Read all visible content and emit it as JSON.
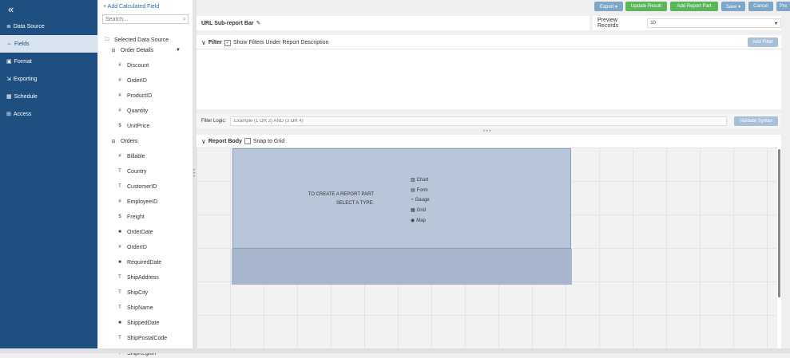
{
  "nav": {
    "collapse_glyph": "«",
    "items": [
      {
        "label": "Data Source",
        "icon": "≣"
      },
      {
        "label": "Fields",
        "icon": "⇔"
      },
      {
        "label": "Format",
        "icon": "▣"
      },
      {
        "label": "Exporting",
        "icon": "⇲"
      },
      {
        "label": "Schedule",
        "icon": "▦"
      },
      {
        "label": "Access",
        "icon": "⊞"
      }
    ]
  },
  "fields_panel": {
    "add_calc": "+ Add Calculated Field",
    "search_placeholder": "Search...",
    "root": "Selected Data Source",
    "groups": [
      {
        "name": "Order Details",
        "fields": [
          {
            "icon": "#",
            "name": "Discount"
          },
          {
            "icon": "#",
            "name": "OrderID"
          },
          {
            "icon": "#",
            "name": "ProductID"
          },
          {
            "icon": "#",
            "name": "Quantity"
          },
          {
            "icon": "$",
            "name": "UnitPrice"
          }
        ]
      },
      {
        "name": "Orders",
        "fields": [
          {
            "icon": "#",
            "name": "Billable"
          },
          {
            "icon": "T",
            "name": "Country"
          },
          {
            "icon": "T",
            "name": "CustomerID"
          },
          {
            "icon": "#",
            "name": "EmployeeID"
          },
          {
            "icon": "$",
            "name": "Freight"
          },
          {
            "icon": "■",
            "name": "OrderDate"
          },
          {
            "icon": "#",
            "name": "OrderID"
          },
          {
            "icon": "■",
            "name": "RequiredDate"
          },
          {
            "icon": "T",
            "name": "ShipAddress"
          },
          {
            "icon": "T",
            "name": "ShipCity"
          },
          {
            "icon": "T",
            "name": "ShipName"
          },
          {
            "icon": "■",
            "name": "ShippedDate"
          },
          {
            "icon": "T",
            "name": "ShipPostalCode"
          },
          {
            "icon": "T",
            "name": "ShipRegion"
          }
        ]
      }
    ]
  },
  "toolbar": {
    "export": "Export ▾",
    "update": "Update Result",
    "add_part": "Add Report Part",
    "save": "Save ▾",
    "cancel": "Cancel",
    "preview_btn": "Pre"
  },
  "url_bar": {
    "label": "URL Sub-report Bar"
  },
  "preview": {
    "label": "Preview Records",
    "value": "10"
  },
  "filter": {
    "title": "Filter",
    "show_under": "Show Filters Under Report Description",
    "add_filter": "Add Filter",
    "logic_label": "Filter Logic:",
    "logic_placeholder": "Example (1 OR 2) AND (3 OR 4)",
    "validate": "Validate Syntax"
  },
  "report_body": {
    "title": "Report Body",
    "snap": "Snap to Grid",
    "prompt_line1": "TO CREATE A REPORT PART",
    "prompt_line2": "SELECT A TYPE:",
    "types": [
      {
        "icon": "▥",
        "label": "Chart"
      },
      {
        "icon": "▤",
        "label": "Form"
      },
      {
        "icon": "◔",
        "label": "Gauge"
      },
      {
        "icon": "▦",
        "label": "Grid"
      },
      {
        "icon": "◉",
        "label": "Map"
      }
    ]
  }
}
